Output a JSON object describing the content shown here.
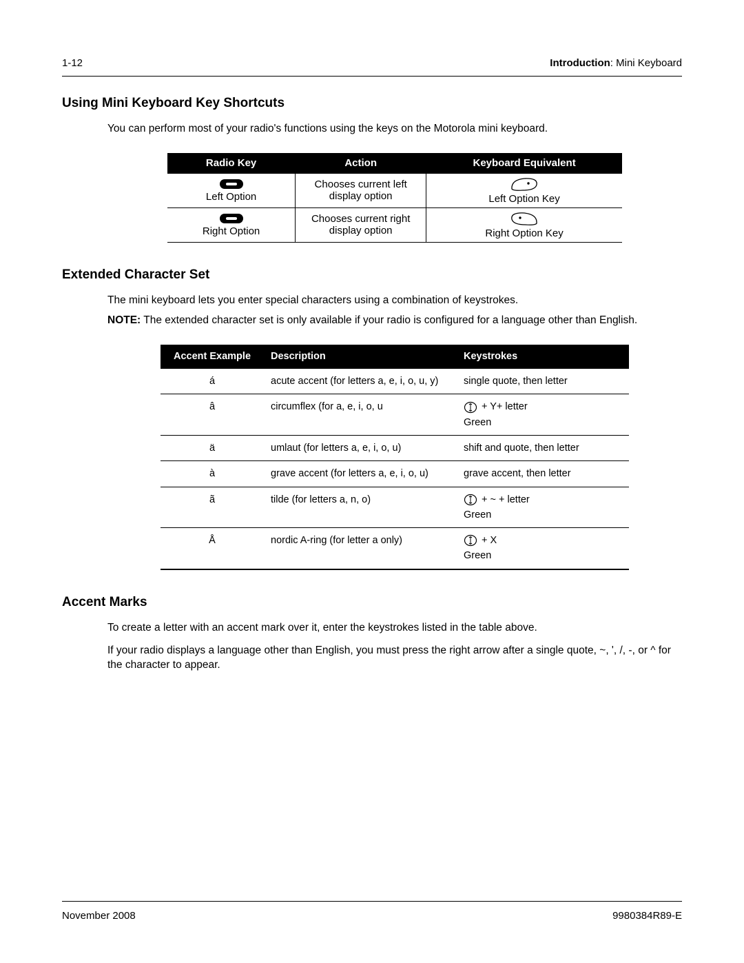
{
  "header": {
    "page_num": "1-12",
    "chapter": "Introduction",
    "section": ": Mini Keyboard"
  },
  "sections": {
    "shortcuts_title": "Using Mini Keyboard Key Shortcuts",
    "shortcuts_intro": "You can perform most of your radio's functions using the keys on the Motorola mini keyboard.",
    "ext_title": "Extended Character Set",
    "ext_intro": "The mini keyboard lets you enter special characters using a combination of keystrokes.",
    "note_label": "NOTE:",
    "note_body": "The extended character set is only available if your radio is configured for a language other than English.",
    "accent_title": "Accent Marks",
    "accent_p1": "To create a letter with an accent mark over it, enter the keystrokes listed in the table above.",
    "accent_p2": "If your radio displays a language other than English, you must press the right arrow after a single quote, ~, ', /, -, or ^ for the character to appear."
  },
  "shortcuts_table": {
    "headers": [
      "Radio Key",
      "Action",
      "Keyboard Equivalent"
    ],
    "rows": [
      {
        "radio_label": "Left Option",
        "action": "Chooses current left display option",
        "key_label": "Left Option Key"
      },
      {
        "radio_label": "Right Option",
        "action": "Chooses current right display option",
        "key_label": "Right Option Key"
      }
    ]
  },
  "accent_table": {
    "headers": [
      "Accent Example",
      "Description",
      "Keystrokes"
    ],
    "green_label": "Green",
    "rows": [
      {
        "ex": "á",
        "desc": "acute accent (for letters a, e, i, o, u, y)",
        "ks_text": "single quote, then letter",
        "has_icon": false
      },
      {
        "ex": "â",
        "desc": "circumflex (for a, e, i, o, u",
        "ks_text": " + Y+ letter",
        "has_icon": true
      },
      {
        "ex": "ä",
        "desc": "umlaut (for letters a, e, i, o, u)",
        "ks_text": "shift and quote, then letter",
        "has_icon": false
      },
      {
        "ex": "à",
        "desc": "grave accent (for letters a, e, i, o, u)",
        "ks_text": "grave accent, then letter",
        "has_icon": false
      },
      {
        "ex": "ã",
        "desc": "tilde (for letters a, n, o)",
        "ks_text": " + ~ + letter",
        "has_icon": true
      },
      {
        "ex": "Å",
        "desc": "nordic A-ring (for letter a only)",
        "ks_text": " + X",
        "has_icon": true
      }
    ]
  },
  "footer": {
    "date": "November 2008",
    "docnum": "9980384R89-E"
  }
}
